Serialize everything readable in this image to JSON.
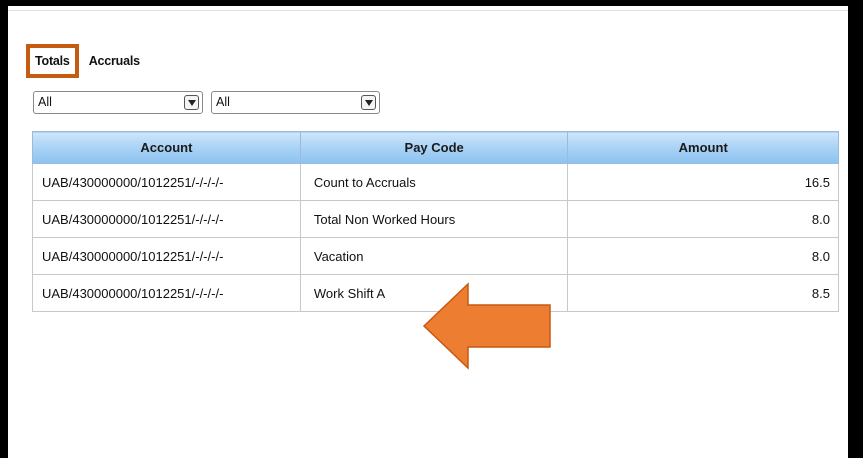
{
  "tabs": [
    {
      "label": "Totals",
      "active": true
    },
    {
      "label": "Accruals",
      "active": false
    }
  ],
  "filters": [
    {
      "value": "All"
    },
    {
      "value": "All"
    }
  ],
  "table": {
    "headers": [
      "Account",
      "Pay Code",
      "Amount"
    ],
    "rows": [
      {
        "account": "UAB/430000000/1012251/-/-/-/-",
        "paycode": "Count to Accruals",
        "amount": "16.5"
      },
      {
        "account": "UAB/430000000/1012251/-/-/-/-",
        "paycode": "Total Non Worked Hours",
        "amount": "8.0"
      },
      {
        "account": "UAB/430000000/1012251/-/-/-/-",
        "paycode": "Vacation",
        "amount": "8.0"
      },
      {
        "account": "UAB/430000000/1012251/-/-/-/-",
        "paycode": "Work Shift A",
        "amount": "8.5"
      }
    ]
  },
  "colors": {
    "highlight_box": "#c55a11",
    "arrow_fill": "#ed7d31",
    "header_blue": "#a9d2f5"
  },
  "icons": {
    "dropdown": "chevron-down-icon",
    "annotation": "left-arrow-icon"
  }
}
